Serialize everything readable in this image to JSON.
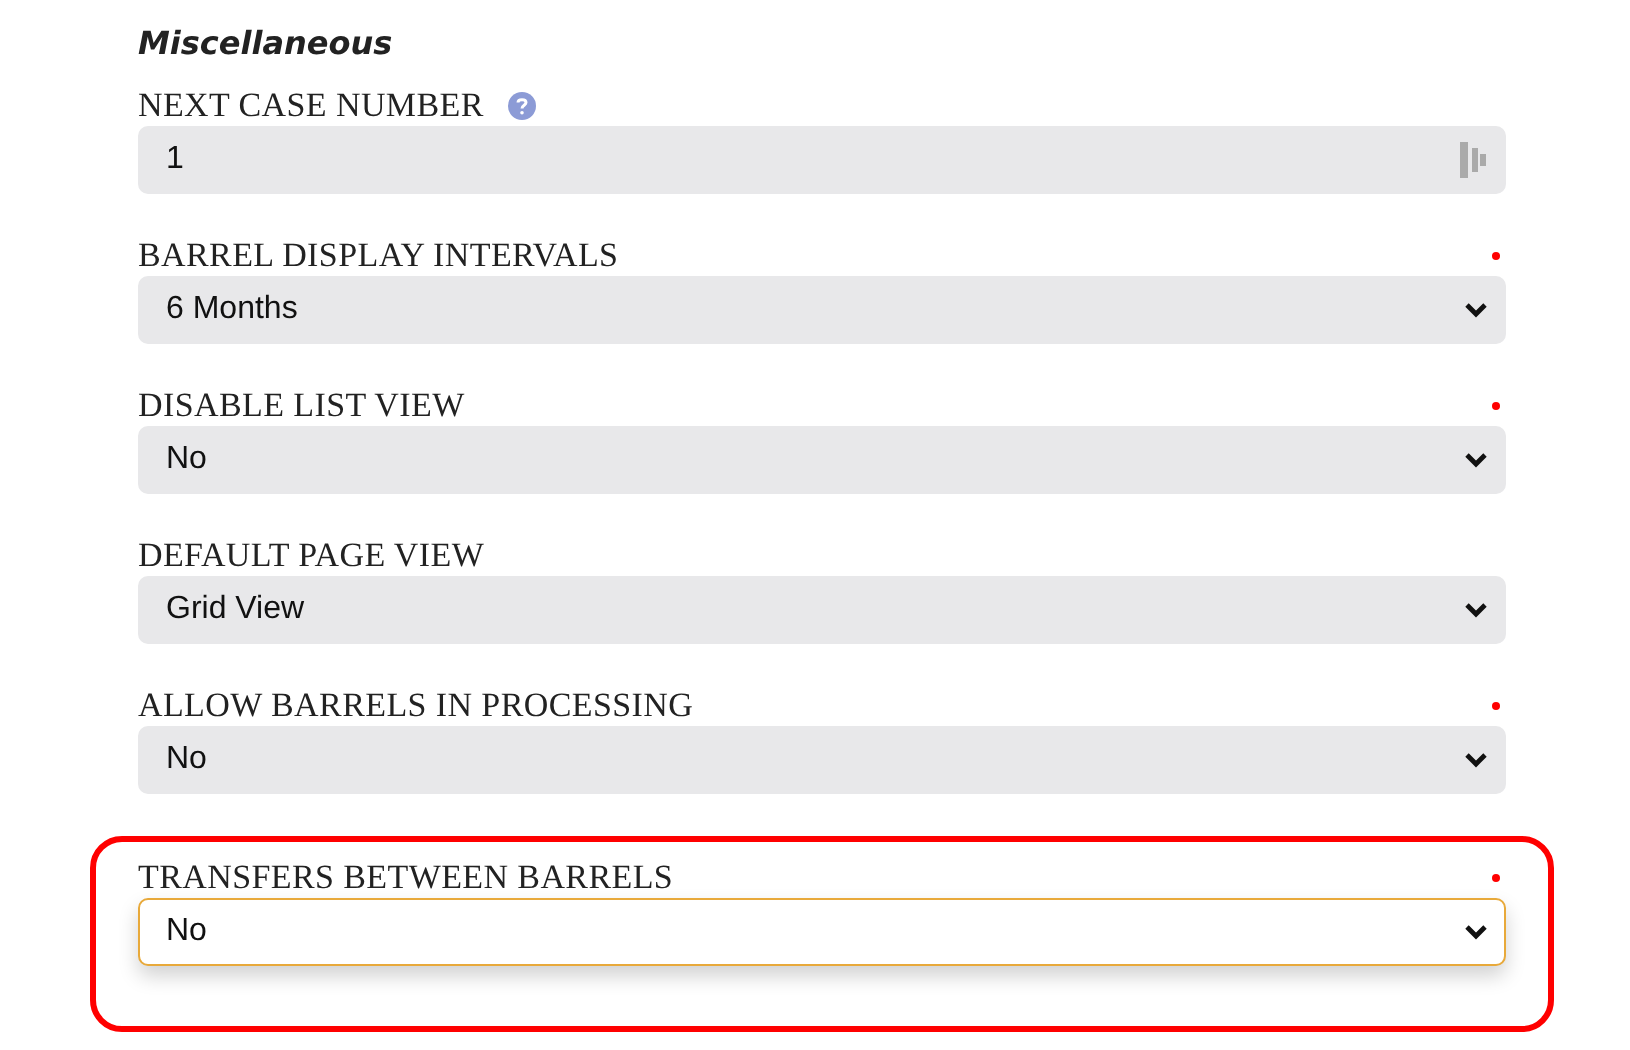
{
  "section": {
    "title": "Miscellaneous"
  },
  "fields": [
    {
      "kind": "text",
      "label": "NEXT CASE NUMBER",
      "help": true,
      "required": false,
      "value": "1",
      "focused": false,
      "highlighted": false
    },
    {
      "kind": "select",
      "label": "BARREL DISPLAY INTERVALS",
      "help": false,
      "required": true,
      "value": "6 Months",
      "focused": false,
      "highlighted": false
    },
    {
      "kind": "select",
      "label": "DISABLE LIST VIEW",
      "help": false,
      "required": true,
      "value": "No",
      "focused": false,
      "highlighted": false
    },
    {
      "kind": "select",
      "label": "DEFAULT PAGE VIEW",
      "help": false,
      "required": false,
      "value": "Grid View",
      "focused": false,
      "highlighted": false
    },
    {
      "kind": "select",
      "label": "ALLOW BARRELS IN PROCESSING",
      "help": false,
      "required": true,
      "value": "No",
      "focused": false,
      "highlighted": false
    },
    {
      "kind": "select",
      "label": "TRANSFERS BETWEEN BARRELS",
      "help": false,
      "required": true,
      "value": "No",
      "focused": true,
      "highlighted": true
    }
  ]
}
